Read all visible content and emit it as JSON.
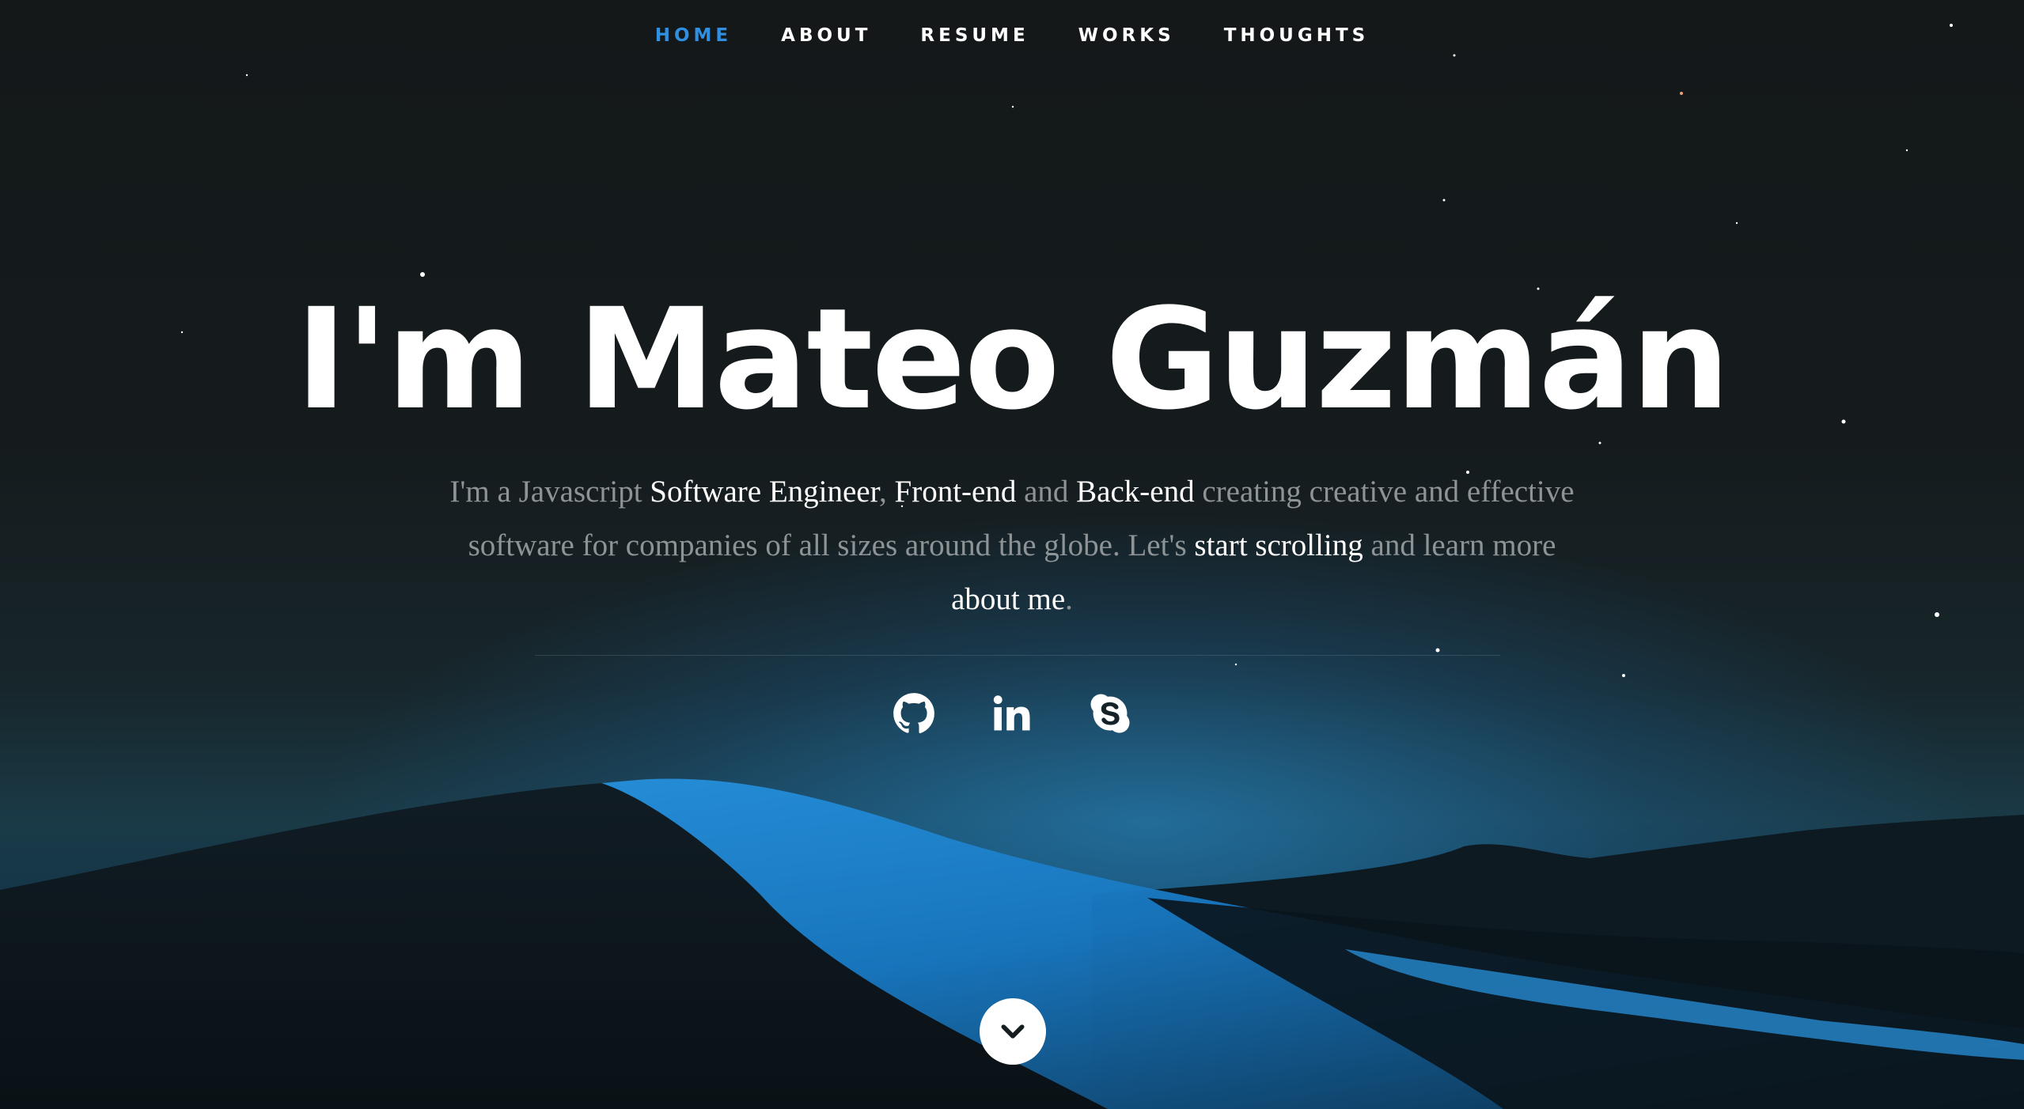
{
  "nav": {
    "items": [
      {
        "label": "HOME",
        "active": true
      },
      {
        "label": "ABOUT",
        "active": false
      },
      {
        "label": "RESUME",
        "active": false
      },
      {
        "label": "WORKS",
        "active": false
      },
      {
        "label": "THOUGHTS",
        "active": false
      }
    ]
  },
  "hero": {
    "title": "I'm Mateo Guzmán",
    "intro": {
      "p1": "I'm a Javascript ",
      "h1": "Software Engineer",
      "p2": ", ",
      "h2": "Front-end",
      "p3": " and ",
      "h3": "Back-end",
      "p4": " creating creative and effective software for companies of all sizes around the globe. Let's ",
      "h4": "start scrolling",
      "p5": " and learn more ",
      "h5": "about me",
      "p6": "."
    }
  },
  "social": [
    {
      "icon": "github-icon"
    },
    {
      "icon": "linkedin-icon"
    },
    {
      "icon": "skype-icon"
    }
  ],
  "scroll_button": {
    "icon": "chevron-down-icon"
  },
  "colors": {
    "accent": "#2f8fe0",
    "text": "#ffffff",
    "muted_text": "#8e9496"
  }
}
